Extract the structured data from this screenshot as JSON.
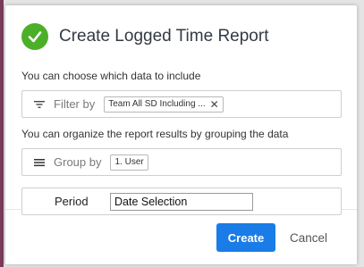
{
  "dialog": {
    "title": "Create Logged Time Report",
    "accent_color": "#4caf28"
  },
  "filter_section": {
    "hint": "You can choose which data to include",
    "label": "Filter by",
    "icon": "filter-icon",
    "chip_text": "Team All SD Including ...",
    "chip_close": "✕"
  },
  "group_section": {
    "hint": "You can organize the report results by grouping the data",
    "label": "Group by",
    "icon": "hamburger-icon",
    "chip_text": "1. User"
  },
  "period_section": {
    "label": "Period",
    "value": "Date Selection"
  },
  "actions": {
    "create_label": "Create",
    "cancel_label": "Cancel",
    "primary_color": "#1a7ce6"
  }
}
